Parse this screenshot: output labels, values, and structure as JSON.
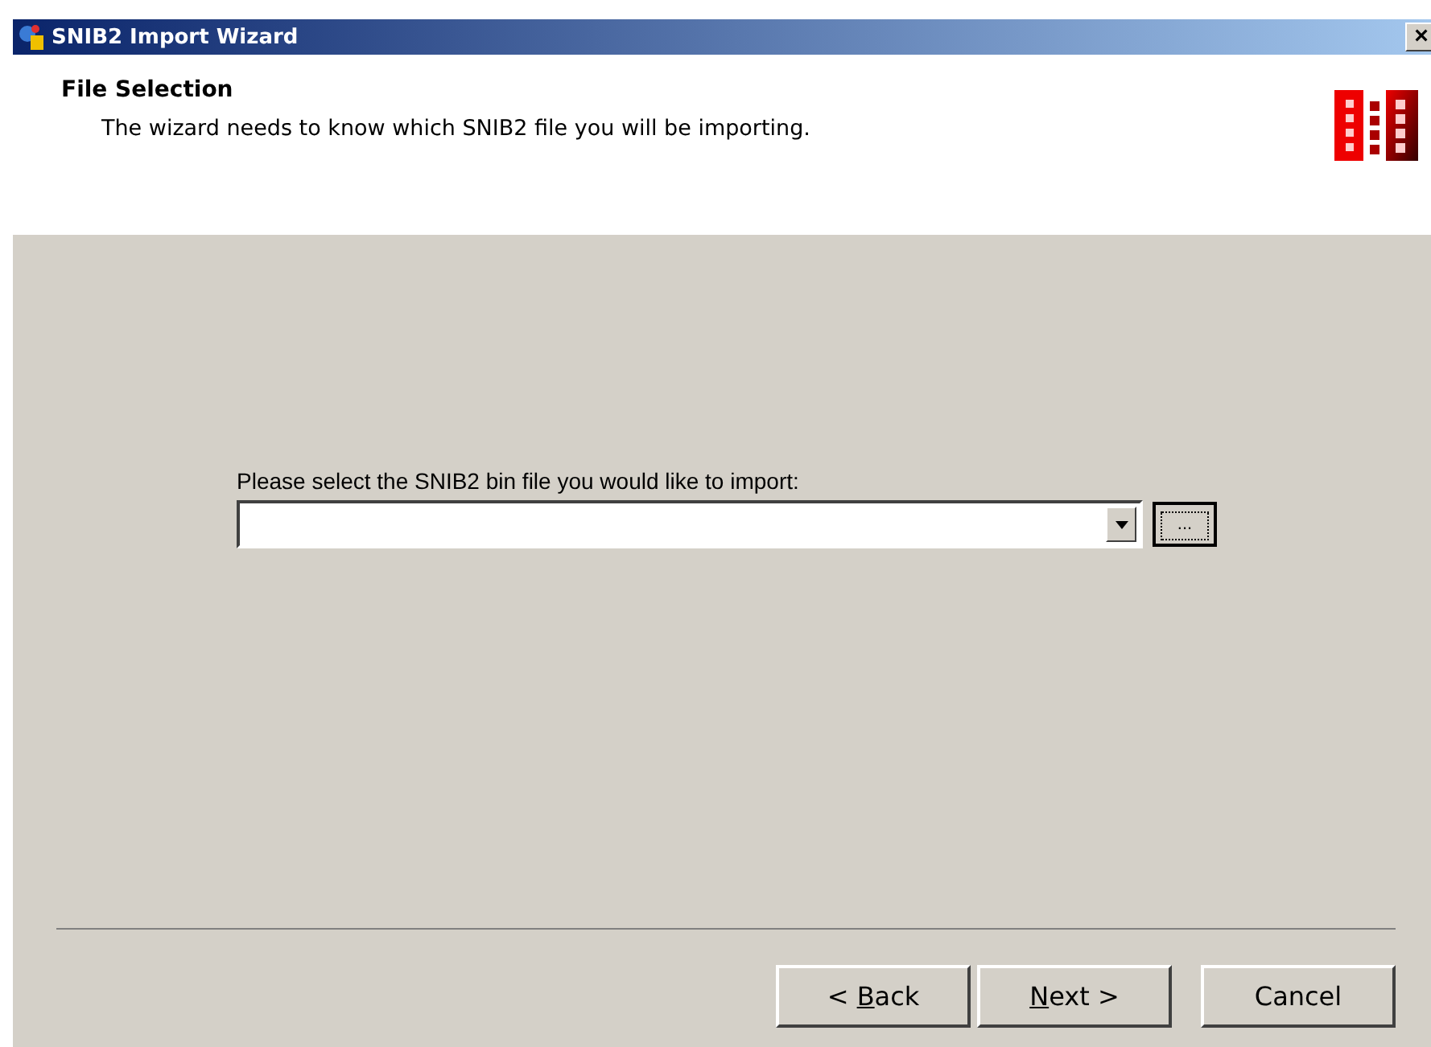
{
  "window": {
    "title": "SNIB2 Import Wizard",
    "close": "×"
  },
  "header": {
    "title": "File Selection",
    "subtitle": "The wizard needs to know which SNIB2 file you will be importing."
  },
  "file_picker": {
    "label": "Please select the SNIB2 bin file you would like to import:",
    "browse": {
      "label": "...",
      "focused": true
    }
  },
  "buttons": [
    {
      "kind": "back",
      "parts": [
        {
          "text": "< ",
          "underlined": false
        },
        {
          "text": "B",
          "underlined": true
        },
        {
          "text": "ack",
          "underlined": false
        }
      ]
    },
    {
      "kind": "next",
      "parts": [
        {
          "text": "N",
          "underlined": true
        },
        {
          "text": "ext >",
          "underlined": false
        }
      ]
    },
    {
      "kind": "cancel",
      "parts": [
        {
          "text": "Cancel",
          "underlined": false
        }
      ]
    }
  ]
}
